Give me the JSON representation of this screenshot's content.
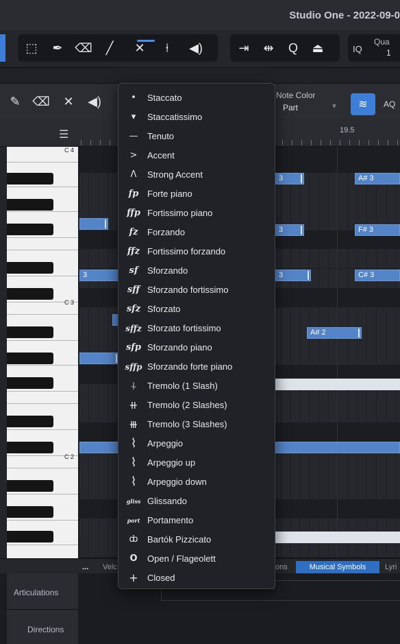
{
  "window": {
    "title": "Studio One - 2022-09-0"
  },
  "toolbar": {
    "icons": [
      "select-icon",
      "range-icon",
      "pencil-icon",
      "eraser-icon",
      "paint-icon",
      "mute-icon",
      "split-icon",
      "listen-icon"
    ],
    "transport_icons": [
      "bend-icon",
      "stretch-icon",
      "quantize-icon",
      "lock-icon"
    ],
    "iq_label": "IQ",
    "quantize_label": "Qua",
    "quantize_value": "1"
  },
  "editor_toolbar": {
    "note_color_label": "Note Color",
    "note_color_value": "Part",
    "aq_label": "AQ"
  },
  "ruler": {
    "position_label": "19.5"
  },
  "keyboard": {
    "labels": [
      "C 4",
      "C 3",
      "C 2"
    ]
  },
  "notes": [
    {
      "label": "3"
    },
    {
      "label": "A# 3"
    },
    {
      "label": "3"
    },
    {
      "label": "F# 3"
    },
    {
      "label": "3"
    },
    {
      "label": "C# 3"
    },
    {
      "label": "3"
    },
    {
      "label": "3"
    },
    {
      "label": "A# 2"
    }
  ],
  "bottom_tabs": {
    "more": "...",
    "velocity": "Velc",
    "actions": "ons",
    "musical_symbols": "Musical Symbols",
    "lyrics": "Lyri"
  },
  "lanes": {
    "articulations": "Articulations",
    "directions": "Directions"
  },
  "menu": {
    "items": [
      {
        "symbol": "•",
        "label": "Staccato"
      },
      {
        "symbol": "▾",
        "label": "Staccatissimo"
      },
      {
        "symbol": "—",
        "label": "Tenuto"
      },
      {
        "symbol": ">",
        "label": "Accent"
      },
      {
        "symbol": "Λ",
        "label": "Strong Accent"
      },
      {
        "symbol": "fp",
        "label": "Forte piano"
      },
      {
        "symbol": "ffp",
        "label": "Fortissimo piano"
      },
      {
        "symbol": "fz",
        "label": "Forzando"
      },
      {
        "symbol": "ffz",
        "label": "Fortissimo forzando"
      },
      {
        "symbol": "sf",
        "label": "Sforzando"
      },
      {
        "symbol": "sff",
        "label": "Sforzando fortissimo"
      },
      {
        "symbol": "sfz",
        "label": "Sforzato"
      },
      {
        "symbol": "sffz",
        "label": "Sforzato fortissimo"
      },
      {
        "symbol": "sfp",
        "label": "Sforzando piano"
      },
      {
        "symbol": "sffp",
        "label": "Sforzando forte piano"
      },
      {
        "symbol": "⍭",
        "label": "Tremolo (1 Slash)"
      },
      {
        "symbol": "⧺",
        "label": "Tremolo (2 Slashes)"
      },
      {
        "symbol": "⧻",
        "label": "Tremolo (3 Slashes)"
      },
      {
        "symbol": "⌇",
        "label": "Arpeggio"
      },
      {
        "symbol": "⌇",
        "label": "Arpeggio up"
      },
      {
        "symbol": "⌇",
        "label": "Arpeggio down"
      },
      {
        "symbol": "gliss",
        "label": "Glissando"
      },
      {
        "symbol": "port",
        "label": "Portamento"
      },
      {
        "symbol": "ȸ",
        "label": "Bartók Pizzicato"
      },
      {
        "symbol": "O",
        "label": "Open / Flageolett"
      },
      {
        "symbol": "+",
        "label": "Closed"
      }
    ]
  }
}
